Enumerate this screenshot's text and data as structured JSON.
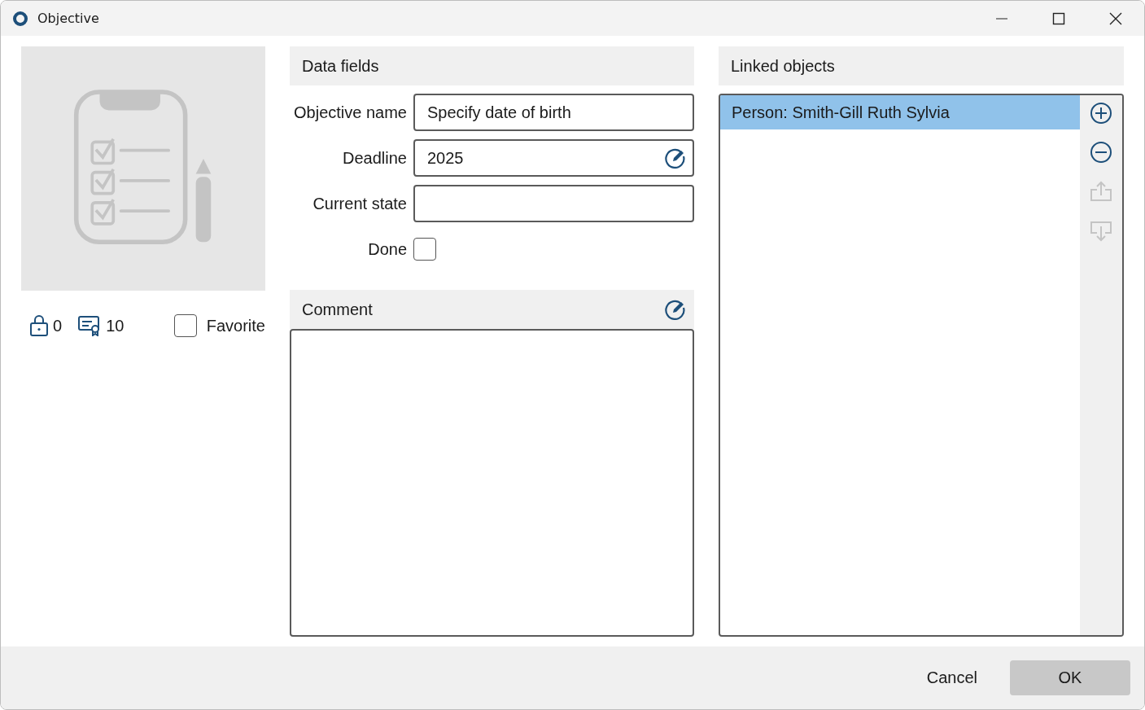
{
  "window": {
    "title": "Objective"
  },
  "stats": {
    "lock_count": "0",
    "certificate_count": "10"
  },
  "favorite": {
    "label": "Favorite",
    "checked": false
  },
  "data_fields": {
    "title": "Data fields",
    "fields": [
      {
        "kind": "text",
        "label": "Objective name",
        "value": "Specify date of birth",
        "editable": false
      },
      {
        "kind": "text",
        "label": "Deadline",
        "value": "2025",
        "editable": true
      },
      {
        "kind": "text",
        "label": "Current state",
        "editable": false
      },
      {
        "kind": "checkbox",
        "label": "Done",
        "checked": false
      }
    ]
  },
  "comment": {
    "title": "Comment"
  },
  "linked_objects": {
    "title": "Linked objects",
    "items": [
      {
        "label": "Person: Smith-Gill Ruth Sylvia",
        "selected": true
      }
    ],
    "actions": [
      {
        "kind": "add",
        "disabled": false
      },
      {
        "kind": "remove",
        "disabled": false
      },
      {
        "kind": "export",
        "disabled": true
      },
      {
        "kind": "import",
        "disabled": true
      }
    ]
  },
  "buttons": [
    {
      "label": "Cancel",
      "kind": "plain"
    },
    {
      "label": "OK",
      "kind": "primary"
    }
  ]
}
